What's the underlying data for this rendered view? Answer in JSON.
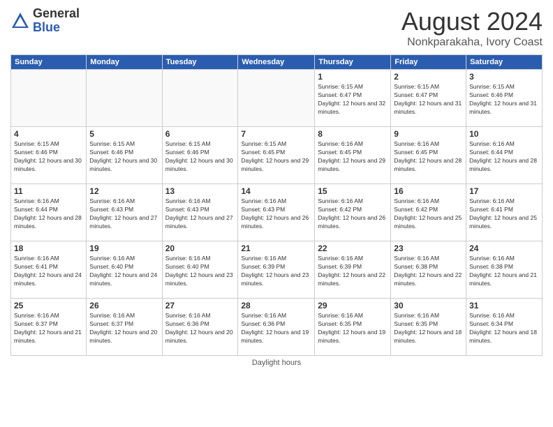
{
  "header": {
    "logo_general": "General",
    "logo_blue": "Blue",
    "month_year": "August 2024",
    "location": "Nonkparakaha, Ivory Coast"
  },
  "days_of_week": [
    "Sunday",
    "Monday",
    "Tuesday",
    "Wednesday",
    "Thursday",
    "Friday",
    "Saturday"
  ],
  "footer": "Daylight hours",
  "weeks": [
    [
      {
        "day": "",
        "empty": true
      },
      {
        "day": "",
        "empty": true
      },
      {
        "day": "",
        "empty": true
      },
      {
        "day": "",
        "empty": true
      },
      {
        "day": "1",
        "sunrise": "6:15 AM",
        "sunset": "6:47 PM",
        "daylight": "12 hours and 32 minutes."
      },
      {
        "day": "2",
        "sunrise": "6:15 AM",
        "sunset": "6:47 PM",
        "daylight": "12 hours and 31 minutes."
      },
      {
        "day": "3",
        "sunrise": "6:15 AM",
        "sunset": "6:46 PM",
        "daylight": "12 hours and 31 minutes."
      }
    ],
    [
      {
        "day": "4",
        "sunrise": "6:15 AM",
        "sunset": "6:46 PM",
        "daylight": "12 hours and 30 minutes."
      },
      {
        "day": "5",
        "sunrise": "6:15 AM",
        "sunset": "6:46 PM",
        "daylight": "12 hours and 30 minutes."
      },
      {
        "day": "6",
        "sunrise": "6:15 AM",
        "sunset": "6:46 PM",
        "daylight": "12 hours and 30 minutes."
      },
      {
        "day": "7",
        "sunrise": "6:15 AM",
        "sunset": "6:45 PM",
        "daylight": "12 hours and 29 minutes."
      },
      {
        "day": "8",
        "sunrise": "6:16 AM",
        "sunset": "6:45 PM",
        "daylight": "12 hours and 29 minutes."
      },
      {
        "day": "9",
        "sunrise": "6:16 AM",
        "sunset": "6:45 PM",
        "daylight": "12 hours and 28 minutes."
      },
      {
        "day": "10",
        "sunrise": "6:16 AM",
        "sunset": "6:44 PM",
        "daylight": "12 hours and 28 minutes."
      }
    ],
    [
      {
        "day": "11",
        "sunrise": "6:16 AM",
        "sunset": "6:44 PM",
        "daylight": "12 hours and 28 minutes."
      },
      {
        "day": "12",
        "sunrise": "6:16 AM",
        "sunset": "6:43 PM",
        "daylight": "12 hours and 27 minutes."
      },
      {
        "day": "13",
        "sunrise": "6:16 AM",
        "sunset": "6:43 PM",
        "daylight": "12 hours and 27 minutes."
      },
      {
        "day": "14",
        "sunrise": "6:16 AM",
        "sunset": "6:43 PM",
        "daylight": "12 hours and 26 minutes."
      },
      {
        "day": "15",
        "sunrise": "6:16 AM",
        "sunset": "6:42 PM",
        "daylight": "12 hours and 26 minutes."
      },
      {
        "day": "16",
        "sunrise": "6:16 AM",
        "sunset": "6:42 PM",
        "daylight": "12 hours and 25 minutes."
      },
      {
        "day": "17",
        "sunrise": "6:16 AM",
        "sunset": "6:41 PM",
        "daylight": "12 hours and 25 minutes."
      }
    ],
    [
      {
        "day": "18",
        "sunrise": "6:16 AM",
        "sunset": "6:41 PM",
        "daylight": "12 hours and 24 minutes."
      },
      {
        "day": "19",
        "sunrise": "6:16 AM",
        "sunset": "6:40 PM",
        "daylight": "12 hours and 24 minutes."
      },
      {
        "day": "20",
        "sunrise": "6:16 AM",
        "sunset": "6:40 PM",
        "daylight": "12 hours and 23 minutes."
      },
      {
        "day": "21",
        "sunrise": "6:16 AM",
        "sunset": "6:39 PM",
        "daylight": "12 hours and 23 minutes."
      },
      {
        "day": "22",
        "sunrise": "6:16 AM",
        "sunset": "6:39 PM",
        "daylight": "12 hours and 22 minutes."
      },
      {
        "day": "23",
        "sunrise": "6:16 AM",
        "sunset": "6:38 PM",
        "daylight": "12 hours and 22 minutes."
      },
      {
        "day": "24",
        "sunrise": "6:16 AM",
        "sunset": "6:38 PM",
        "daylight": "12 hours and 21 minutes."
      }
    ],
    [
      {
        "day": "25",
        "sunrise": "6:16 AM",
        "sunset": "6:37 PM",
        "daylight": "12 hours and 21 minutes."
      },
      {
        "day": "26",
        "sunrise": "6:16 AM",
        "sunset": "6:37 PM",
        "daylight": "12 hours and 20 minutes."
      },
      {
        "day": "27",
        "sunrise": "6:16 AM",
        "sunset": "6:36 PM",
        "daylight": "12 hours and 20 minutes."
      },
      {
        "day": "28",
        "sunrise": "6:16 AM",
        "sunset": "6:36 PM",
        "daylight": "12 hours and 19 minutes."
      },
      {
        "day": "29",
        "sunrise": "6:16 AM",
        "sunset": "6:35 PM",
        "daylight": "12 hours and 19 minutes."
      },
      {
        "day": "30",
        "sunrise": "6:16 AM",
        "sunset": "6:35 PM",
        "daylight": "12 hours and 18 minutes."
      },
      {
        "day": "31",
        "sunrise": "6:16 AM",
        "sunset": "6:34 PM",
        "daylight": "12 hours and 18 minutes."
      }
    ]
  ]
}
